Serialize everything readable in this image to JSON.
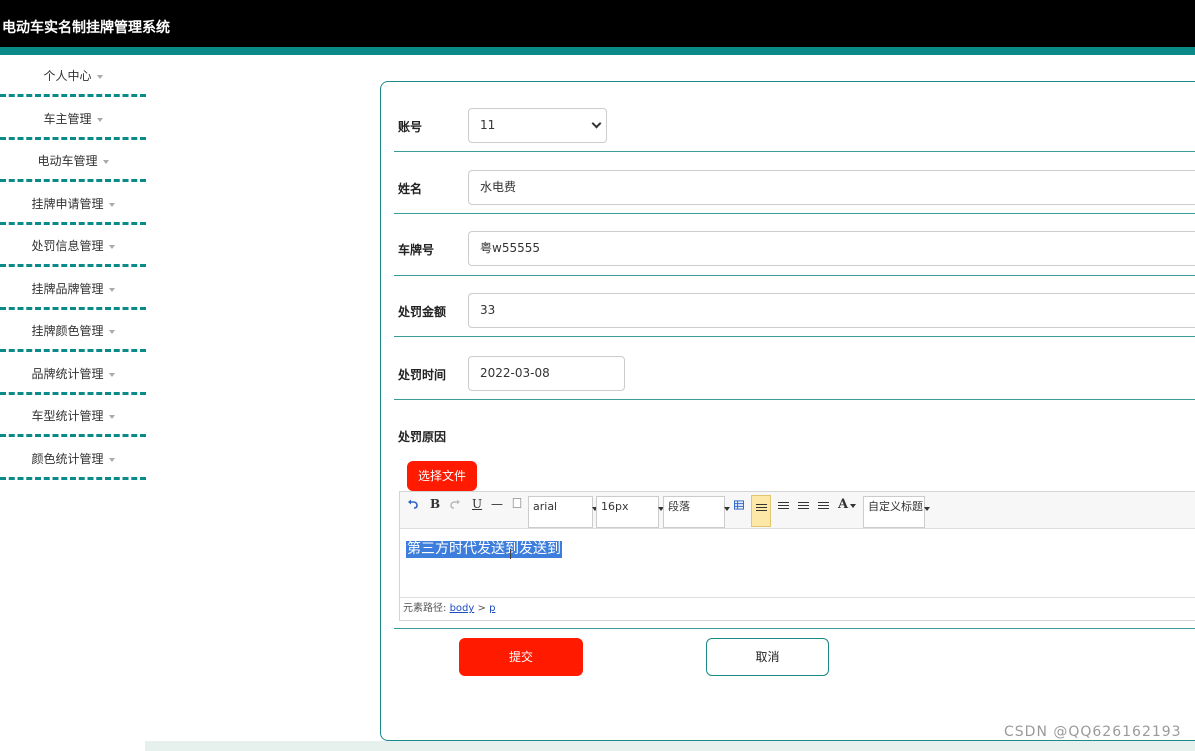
{
  "app": {
    "title": "电动车实名制挂牌管理系统"
  },
  "sidebar": {
    "items": [
      {
        "label": "个人中心"
      },
      {
        "label": "车主管理"
      },
      {
        "label": "电动车管理"
      },
      {
        "label": "挂牌申请管理"
      },
      {
        "label": "处罚信息管理"
      },
      {
        "label": "挂牌品牌管理"
      },
      {
        "label": "挂牌颜色管理"
      },
      {
        "label": "品牌统计管理"
      },
      {
        "label": "车型统计管理"
      },
      {
        "label": "颜色统计管理"
      }
    ]
  },
  "form": {
    "account": {
      "label": "账号",
      "value": "11"
    },
    "name": {
      "label": "姓名",
      "value": "水电费"
    },
    "plate": {
      "label": "车牌号",
      "value": "粤w55555"
    },
    "amount": {
      "label": "处罚金额",
      "value": "33"
    },
    "time": {
      "label": "处罚时间",
      "value": "2022-03-08"
    },
    "reason": {
      "label": "处罚原因"
    }
  },
  "editor": {
    "upload_label": "选择文件",
    "toolbar": {
      "bold": "B",
      "underline": "U",
      "hr": "—",
      "font_family": "arial",
      "font_size": "16px",
      "paragraph": "段落",
      "font_color": "A",
      "custom_title": "自定义标题"
    },
    "content": "第三方时代发送到发送到",
    "status_prefix": "元素路径:",
    "path_body": "body",
    "path_sep": ">",
    "path_p": "p"
  },
  "actions": {
    "submit": "提交",
    "cancel": "取消"
  },
  "watermark": "CSDN @QQ626162193"
}
